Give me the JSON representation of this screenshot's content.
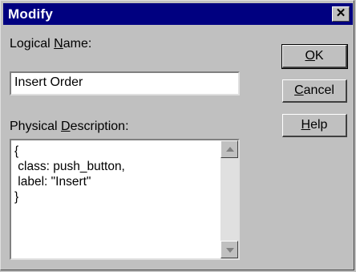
{
  "window": {
    "title": "Modify",
    "close_label": "✕"
  },
  "logical_name": {
    "label_pre": "Logical ",
    "label_ul": "N",
    "label_post": "ame:",
    "value": "Insert Order"
  },
  "physical_description": {
    "label_pre": "Physical ",
    "label_ul": "D",
    "label_post": "escription:",
    "value": "{\n class: push_button,\n label: \"Insert\"\n}"
  },
  "buttons": {
    "ok": {
      "ul": "O",
      "rest": "K"
    },
    "cancel": {
      "ul": "C",
      "rest": "ancel"
    },
    "help": {
      "ul": "H",
      "rest": "elp"
    }
  },
  "icons": {
    "scroll_up": "scroll-up-arrow-icon",
    "scroll_down": "scroll-down-arrow-icon",
    "close": "close-icon"
  }
}
